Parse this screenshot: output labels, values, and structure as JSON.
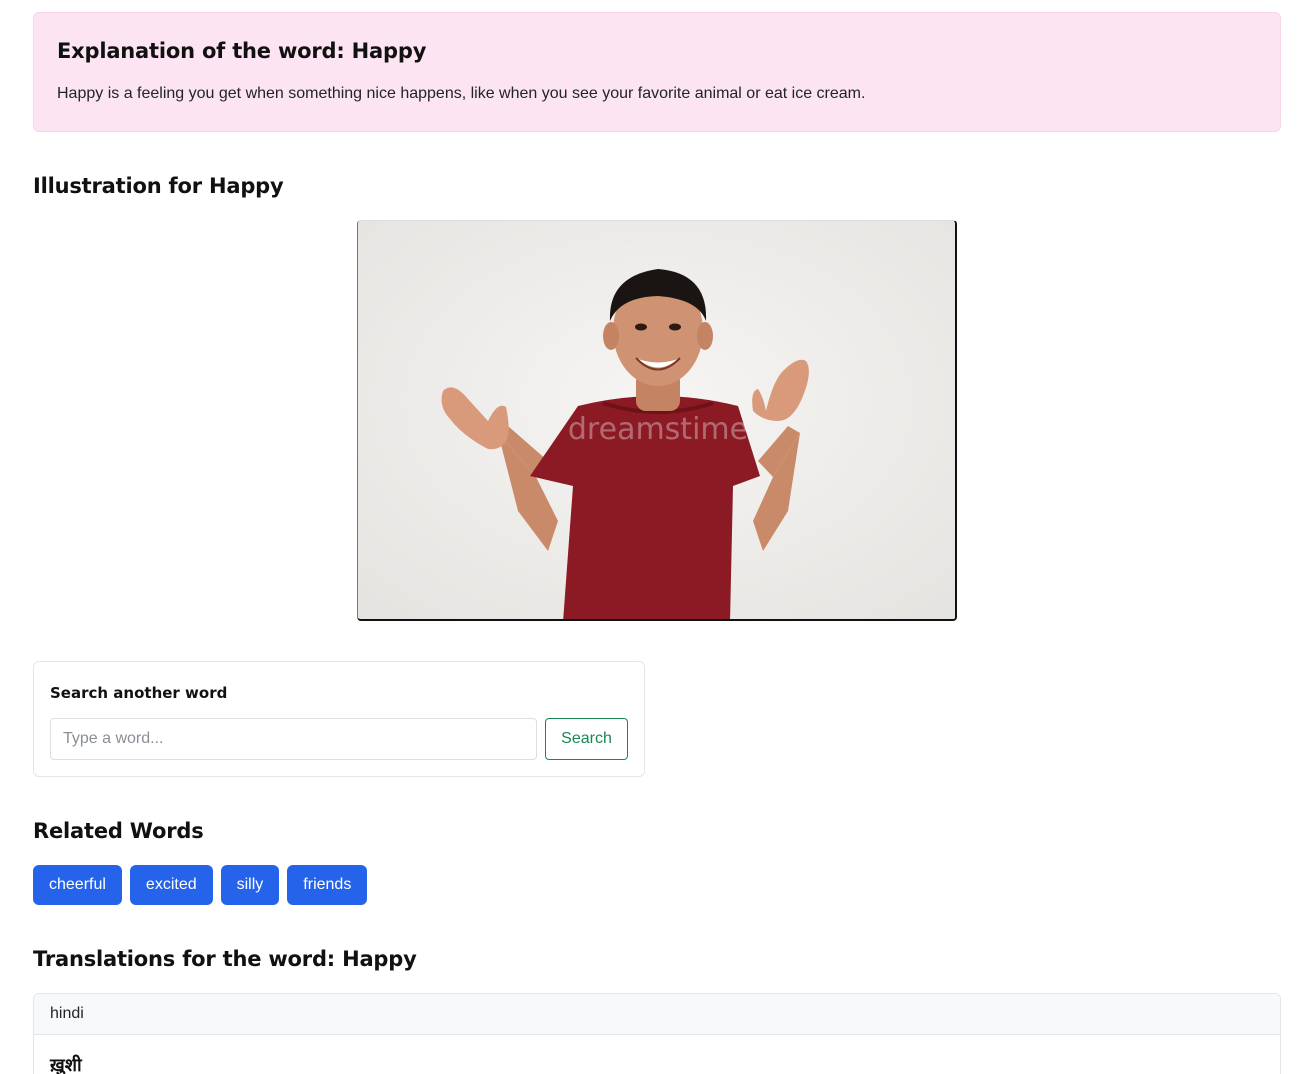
{
  "explanation": {
    "title": "Explanation of the word: Happy",
    "text": "Happy is a feeling you get when something nice happens, like when you see your favorite animal or eat ice cream."
  },
  "illustration": {
    "heading": "Illustration for Happy",
    "image_description_icon": "happy-child-photo",
    "watermark": "dreamstime"
  },
  "search": {
    "label": "Search another word",
    "placeholder": "Type a word...",
    "value": "",
    "button_label": "Search"
  },
  "related": {
    "heading": "Related Words",
    "words": [
      "cheerful",
      "excited",
      "silly",
      "friends"
    ]
  },
  "translations": {
    "heading": "Translations for the word: Happy",
    "items": [
      {
        "language": "hindi",
        "word": "ख़ुशी"
      }
    ]
  },
  "colors": {
    "explain_bg": "#fce4f2",
    "chip_bg": "#2563eb",
    "search_button": "#198754",
    "shirt": "#8b1a24"
  }
}
